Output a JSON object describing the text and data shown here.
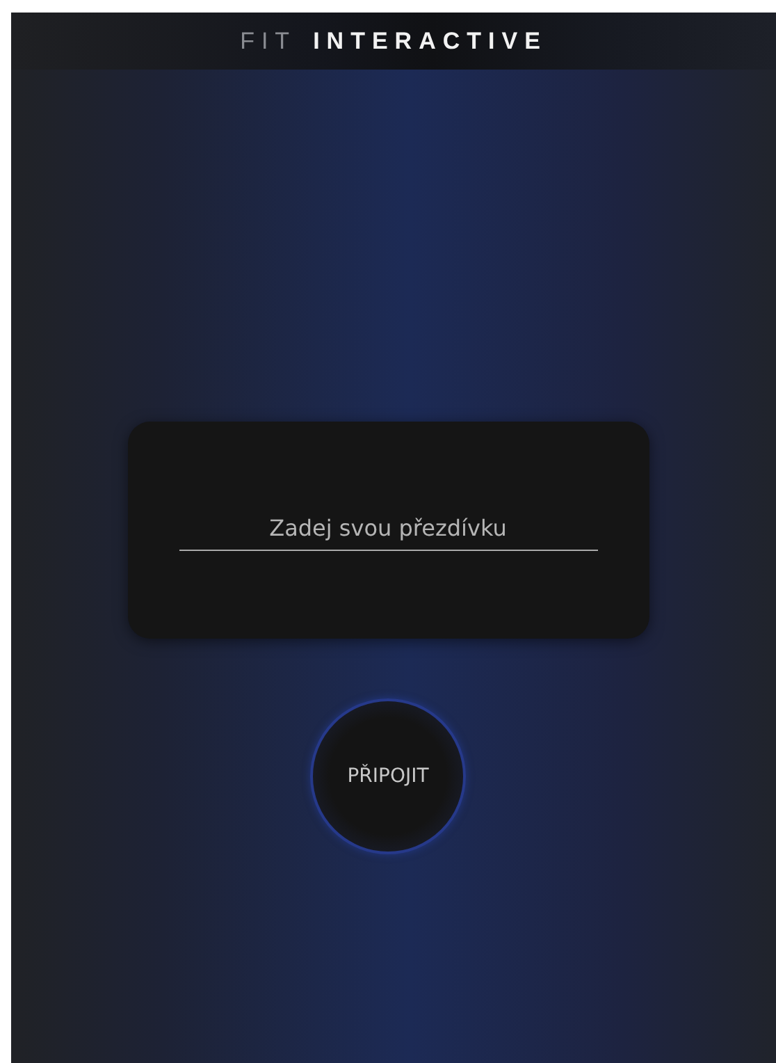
{
  "header": {
    "logo": [
      {
        "text": "FIT",
        "kind": "dim"
      },
      {
        "text": "INTERACTIVE",
        "kind": "bright"
      }
    ]
  },
  "form": {
    "nickname": {
      "placeholder": "Zadej svou přezdívku"
    }
  },
  "connect_button": {
    "label": "PŘIPOJIT"
  }
}
